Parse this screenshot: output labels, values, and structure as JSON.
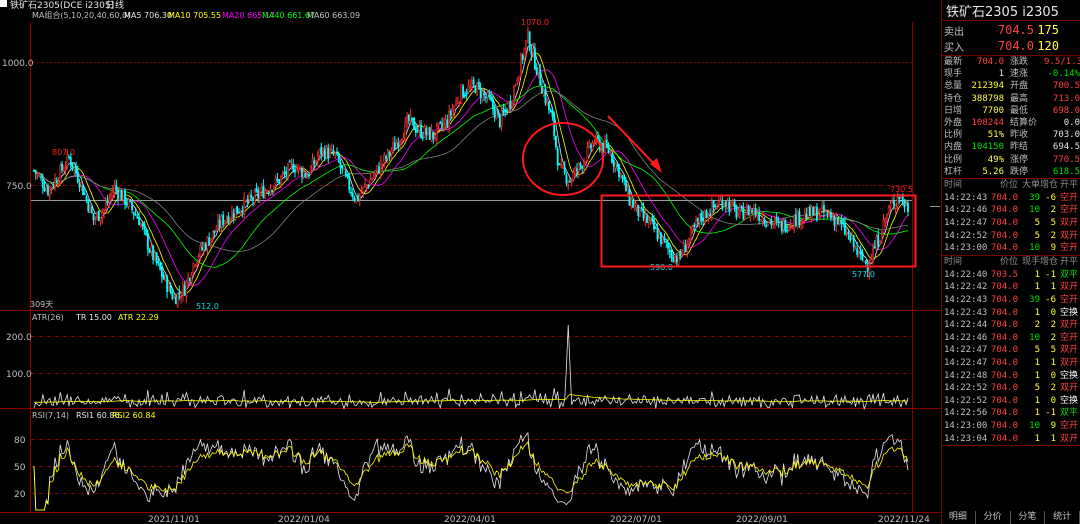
{
  "chart_title": "铁矿石2305(DCE i2305)",
  "period": "日线",
  "ma_legend": {
    "label": "MA组合(5,10,20,40,60,0)",
    "ma5": "MA5 706.30",
    "ma10": "MA10 705.55",
    "ma20": "MA20 665.17",
    "ma40": "MA40 661.67",
    "ma60": "MA60 663.09"
  },
  "atr_legend": {
    "label": "ATR(26)",
    "tr": "TR 15.00",
    "atr": "ATR 22.29"
  },
  "rsi_legend": {
    "label": "RSI(7,14)",
    "rsi1": "RSI1 60.86",
    "rsi2": "RSI2 60.84"
  },
  "annotations": {
    "high_label": "1070.0",
    "low_label": "512.0",
    "left_peak_label": "807.0",
    "box_left_low": "590.0",
    "box_right_low": "577.0",
    "box_right_high": "730.5",
    "days_label": "309天"
  },
  "colors": {
    "up": "#ff3030",
    "down": "#00ffff",
    "ma5": "#e6e6e6",
    "ma10": "#ffff00",
    "ma20": "#ff00ff",
    "ma40": "#00ff00",
    "ma60": "#808080",
    "annotation": "#ff2020"
  },
  "chart_data": {
    "type": "candlestick",
    "y_ticks_main": [
      "1000.0",
      "750.0"
    ],
    "ylim_main": [
      500,
      1090
    ],
    "x_ticks": [
      "2021/11/01",
      "2022/01/04",
      "2022/04/01",
      "2022/07/01",
      "2022/09/01",
      "2022/11/24"
    ],
    "atr_ticks": [
      "200.0",
      "100.0"
    ],
    "rsi_ticks": [
      "80",
      "50",
      "20"
    ],
    "close_path_estimate": [
      [
        0,
        780
      ],
      [
        8,
        740
      ],
      [
        14,
        770
      ],
      [
        20,
        805
      ],
      [
        26,
        760
      ],
      [
        34,
        680
      ],
      [
        40,
        700
      ],
      [
        46,
        745
      ],
      [
        52,
        720
      ],
      [
        60,
        680
      ],
      [
        66,
        620
      ],
      [
        74,
        560
      ],
      [
        80,
        520
      ],
      [
        86,
        540
      ],
      [
        92,
        600
      ],
      [
        100,
        640
      ],
      [
        108,
        680
      ],
      [
        116,
        700
      ],
      [
        124,
        720
      ],
      [
        132,
        740
      ],
      [
        140,
        760
      ],
      [
        148,
        790
      ],
      [
        156,
        770
      ],
      [
        164,
        820
      ],
      [
        172,
        810
      ],
      [
        178,
        760
      ],
      [
        184,
        720
      ],
      [
        190,
        750
      ],
      [
        198,
        790
      ],
      [
        206,
        830
      ],
      [
        214,
        880
      ],
      [
        220,
        860
      ],
      [
        228,
        850
      ],
      [
        236,
        880
      ],
      [
        244,
        940
      ],
      [
        252,
        950
      ],
      [
        260,
        920
      ],
      [
        266,
        880
      ],
      [
        272,
        920
      ],
      [
        278,
        1000
      ],
      [
        282,
        1050
      ],
      [
        286,
        1000
      ],
      [
        290,
        950
      ],
      [
        296,
        880
      ],
      [
        300,
        780
      ],
      [
        306,
        760
      ],
      [
        312,
        790
      ],
      [
        320,
        840
      ],
      [
        328,
        820
      ],
      [
        334,
        780
      ],
      [
        340,
        720
      ],
      [
        346,
        690
      ],
      [
        352,
        670
      ],
      [
        358,
        640
      ],
      [
        364,
        610
      ],
      [
        368,
        600
      ],
      [
        374,
        640
      ],
      [
        380,
        680
      ],
      [
        386,
        700
      ],
      [
        394,
        720
      ],
      [
        402,
        690
      ],
      [
        410,
        700
      ],
      [
        418,
        680
      ],
      [
        426,
        665
      ],
      [
        434,
        680
      ],
      [
        442,
        690
      ],
      [
        450,
        695
      ],
      [
        458,
        680
      ],
      [
        466,
        640
      ],
      [
        472,
        600
      ],
      [
        476,
        590
      ],
      [
        482,
        640
      ],
      [
        488,
        700
      ],
      [
        494,
        730
      ],
      [
        498,
        705
      ]
    ]
  },
  "side": {
    "title": "铁矿石2305  i2305",
    "sell_label": "卖出",
    "sell_price": "704.5",
    "sell_vol": "175",
    "buy_label": "买入",
    "buy_price": "704.0",
    "buy_vol": "120",
    "stats": [
      [
        "最新",
        "704.0",
        "涨跌",
        "9.5/1.37%"
      ],
      [
        "现手",
        "1",
        "速涨",
        "-0.14%"
      ],
      [
        "总量",
        "212394",
        "开盘",
        "700.5"
      ],
      [
        "持仓",
        "388798",
        "最高",
        "713.0"
      ],
      [
        "日增",
        "7700",
        "最低",
        "698.0"
      ],
      [
        "外盘",
        "108244",
        "结算价",
        "0.0"
      ],
      [
        "比例",
        "51%",
        "昨收",
        "703.0"
      ],
      [
        "内盘",
        "104150",
        "昨结",
        "694.5"
      ],
      [
        "比例",
        "49%",
        "涨停",
        "770.5"
      ],
      [
        "杠杆",
        "5.26",
        "跌停",
        "618.5"
      ]
    ],
    "tick_header1": [
      "时间",
      "价位",
      "大单",
      "增仓",
      "开平"
    ],
    "ticks1": [
      [
        "14:22:43",
        "704.0",
        "39",
        "-6",
        "空开"
      ],
      [
        "14:22:46",
        "704.0",
        "10",
        "2",
        "空开"
      ],
      [
        "14:22:47",
        "704.0",
        "5",
        "5",
        "双开"
      ],
      [
        "14:22:52",
        "704.0",
        "5",
        "2",
        "双开"
      ],
      [
        "14:23:00",
        "704.0",
        "10",
        "9",
        "空开"
      ]
    ],
    "tick_header2": [
      "时间",
      "价位",
      "现手",
      "增仓",
      "开平"
    ],
    "ticks2": [
      [
        "14:22:40",
        "703.5",
        "1",
        "-1",
        "双平"
      ],
      [
        "14:22:42",
        "704.0",
        "1",
        "1",
        "双开"
      ],
      [
        "14:22:43",
        "704.0",
        "39",
        "-6",
        "空开"
      ],
      [
        "14:22:43",
        "704.0",
        "1",
        "0",
        "空换"
      ],
      [
        "14:22:44",
        "704.0",
        "2",
        "2",
        "双开"
      ],
      [
        "14:22:46",
        "704.0",
        "10",
        "2",
        "空开"
      ],
      [
        "14:22:47",
        "704.0",
        "5",
        "5",
        "双开"
      ],
      [
        "14:22:47",
        "704.0",
        "1",
        "1",
        "双开"
      ],
      [
        "14:22:48",
        "704.0",
        "1",
        "0",
        "空换"
      ],
      [
        "14:22:52",
        "704.0",
        "5",
        "2",
        "双开"
      ],
      [
        "14:22:52",
        "704.0",
        "1",
        "0",
        "空换"
      ],
      [
        "14:22:56",
        "704.0",
        "1",
        "-1",
        "双平"
      ],
      [
        "14:23:00",
        "704.0",
        "10",
        "9",
        "空开"
      ],
      [
        "14:23:04",
        "704.0",
        "1",
        "1",
        "双开"
      ]
    ],
    "tabs": [
      "明细",
      "分价",
      "分笔",
      "统计"
    ]
  }
}
